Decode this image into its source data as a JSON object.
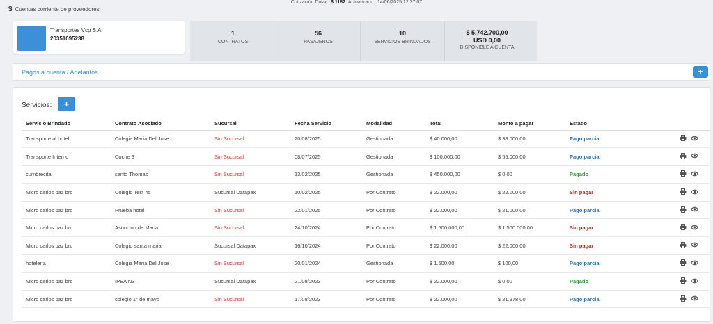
{
  "breadcrumb": {
    "icon": "dollar-icon",
    "label": "Cuentas corriente de proveedores"
  },
  "rate": {
    "label": "Cotización Dolar :",
    "value": "$ 1182",
    "updated_label": "Actualizado : 14/06/2025 12:37:07"
  },
  "company": {
    "name": "Transportes Vcp S.A",
    "cuit": "20351095238",
    "logo_color": "#3c8fd8"
  },
  "stats": [
    {
      "num": "1",
      "num2": "",
      "label": "CONTRATOS"
    },
    {
      "num": "56",
      "num2": "",
      "label": "PASAJEROS"
    },
    {
      "num": "10",
      "num2": "",
      "label": "SERVICIOS BRINDADOS"
    },
    {
      "num": "$ 5.742.700,00",
      "num2": "USD 0,00",
      "label": "DISPONIBLE A CUENTA"
    }
  ],
  "pagos": {
    "label": "Pagos a cuenta / Adelantos",
    "add_label": "+"
  },
  "services": {
    "title": "Servicios:",
    "add_label": "+",
    "columns": [
      "Servicio Brindado",
      "Contrato Asociado",
      "Sucursal",
      "Fecha Servicio",
      "Modalidad",
      "Total",
      "Monto a pagar",
      "Estado",
      ""
    ],
    "rows": [
      {
        "servicio": "Transporte al hotel",
        "contrato": "Colegia Maria Del Jose",
        "sucursal": "Sin Sucursal",
        "fecha": "20/08/2025",
        "modalidad": "Gestionada",
        "total": "$ 40.000,00",
        "monto": "$ 38.000,00",
        "estado": "Pago parcial",
        "estado_type": "parcial"
      },
      {
        "servicio": "Transporte Interno",
        "contrato": "Coche 3",
        "sucursal": "Sin Sucursal",
        "fecha": "08/07/2025",
        "modalidad": "Gestionada",
        "total": "$ 100.000,00",
        "monto": "$ 55.000,00",
        "estado": "Pago parcial",
        "estado_type": "parcial"
      },
      {
        "servicio": "cumbrecita",
        "contrato": "santo Thomas",
        "sucursal": "Sin Sucursal",
        "fecha": "13/02/2025",
        "modalidad": "Gestionada",
        "total": "$ 450.000,00",
        "monto": "$ 0,00",
        "estado": "Pagado",
        "estado_type": "pagado"
      },
      {
        "servicio": "Micro carlos paz brc",
        "contrato": "Colegio Test 45",
        "sucursal": "Sucursal Datapax",
        "fecha": "10/02/2025",
        "modalidad": "Por Contrato",
        "total": "$ 22.000,00",
        "monto": "$ 22.000,00",
        "estado": "Sin pagar",
        "estado_type": "sinpagar"
      },
      {
        "servicio": "Micro carlos paz brc",
        "contrato": "Prueba hotel",
        "sucursal": "Sin Sucursal",
        "fecha": "22/01/2025",
        "modalidad": "Por Contrato",
        "total": "$ 22.000,00",
        "monto": "$ 21.000,00",
        "estado": "Pago parcial",
        "estado_type": "parcial"
      },
      {
        "servicio": "Micro carlos paz brc",
        "contrato": "Asuncion de Maria",
        "sucursal": "Sin Sucursal",
        "fecha": "24/10/2024",
        "modalidad": "Por Contrato",
        "total": "$ 1.500.000,00",
        "monto": "$ 1.500.000,00",
        "estado": "Sin pagar",
        "estado_type": "sinpagar"
      },
      {
        "servicio": "Micro carlos paz brc",
        "contrato": "Colegio santa maria",
        "sucursal": "Sucursal Datapax",
        "fecha": "16/10/2024",
        "modalidad": "Por Contrato",
        "total": "$ 22.000,00",
        "monto": "$ 22.000,00",
        "estado": "Sin pagar",
        "estado_type": "sinpagar"
      },
      {
        "servicio": "hoteleria",
        "contrato": "Colegia Maria Del Jose",
        "sucursal": "Sin Sucursal",
        "fecha": "20/01/2024",
        "modalidad": "Gestionada",
        "total": "$ 1.500,00",
        "monto": "$ 100,00",
        "estado": "Pago parcial",
        "estado_type": "parcial"
      },
      {
        "servicio": "Micro carlos paz brc",
        "contrato": "IPEA N3",
        "sucursal": "Sucursal Datapax",
        "fecha": "21/08/2023",
        "modalidad": "Por Contrato",
        "total": "$ 22.000,00",
        "monto": "$ 0,00",
        "estado": "Pagado",
        "estado_type": "pagado"
      },
      {
        "servicio": "Micro carlos paz brc",
        "contrato": "colegio 1° de mayo",
        "sucursal": "Sin Sucursal",
        "fecha": "17/08/2023",
        "modalidad": "Por Contrato",
        "total": "$ 22.000,00",
        "monto": "$ 21.978,00",
        "estado": "Pago parcial",
        "estado_type": "parcial"
      }
    ],
    "row_icons": [
      "print-icon",
      "eye-icon"
    ]
  },
  "colors": {
    "accent": "#3a8fd9",
    "danger": "#d9362b",
    "success": "#2d9a3a",
    "info": "#2c6fb5",
    "dark_red": "#b22b22"
  }
}
